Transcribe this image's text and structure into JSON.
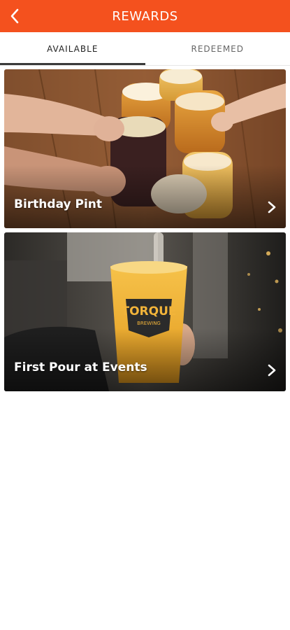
{
  "header": {
    "title": "REWARDS",
    "back_icon": "chevron-left-icon",
    "color": "#f4511e"
  },
  "tabs": [
    {
      "label": "AVAILABLE",
      "active": true
    },
    {
      "label": "REDEEMED",
      "active": false
    }
  ],
  "rewards": [
    {
      "title": "Birthday Pint",
      "image": "beer-toast-photo",
      "chevron_icon": "chevron-right-icon"
    },
    {
      "title": "First Pour at Events",
      "image": "torque-brewing-pour-photo",
      "chevron_icon": "chevron-right-icon"
    }
  ],
  "image_text": {
    "brand_logo": "TORQUE",
    "brand_sub": "BREWING"
  }
}
